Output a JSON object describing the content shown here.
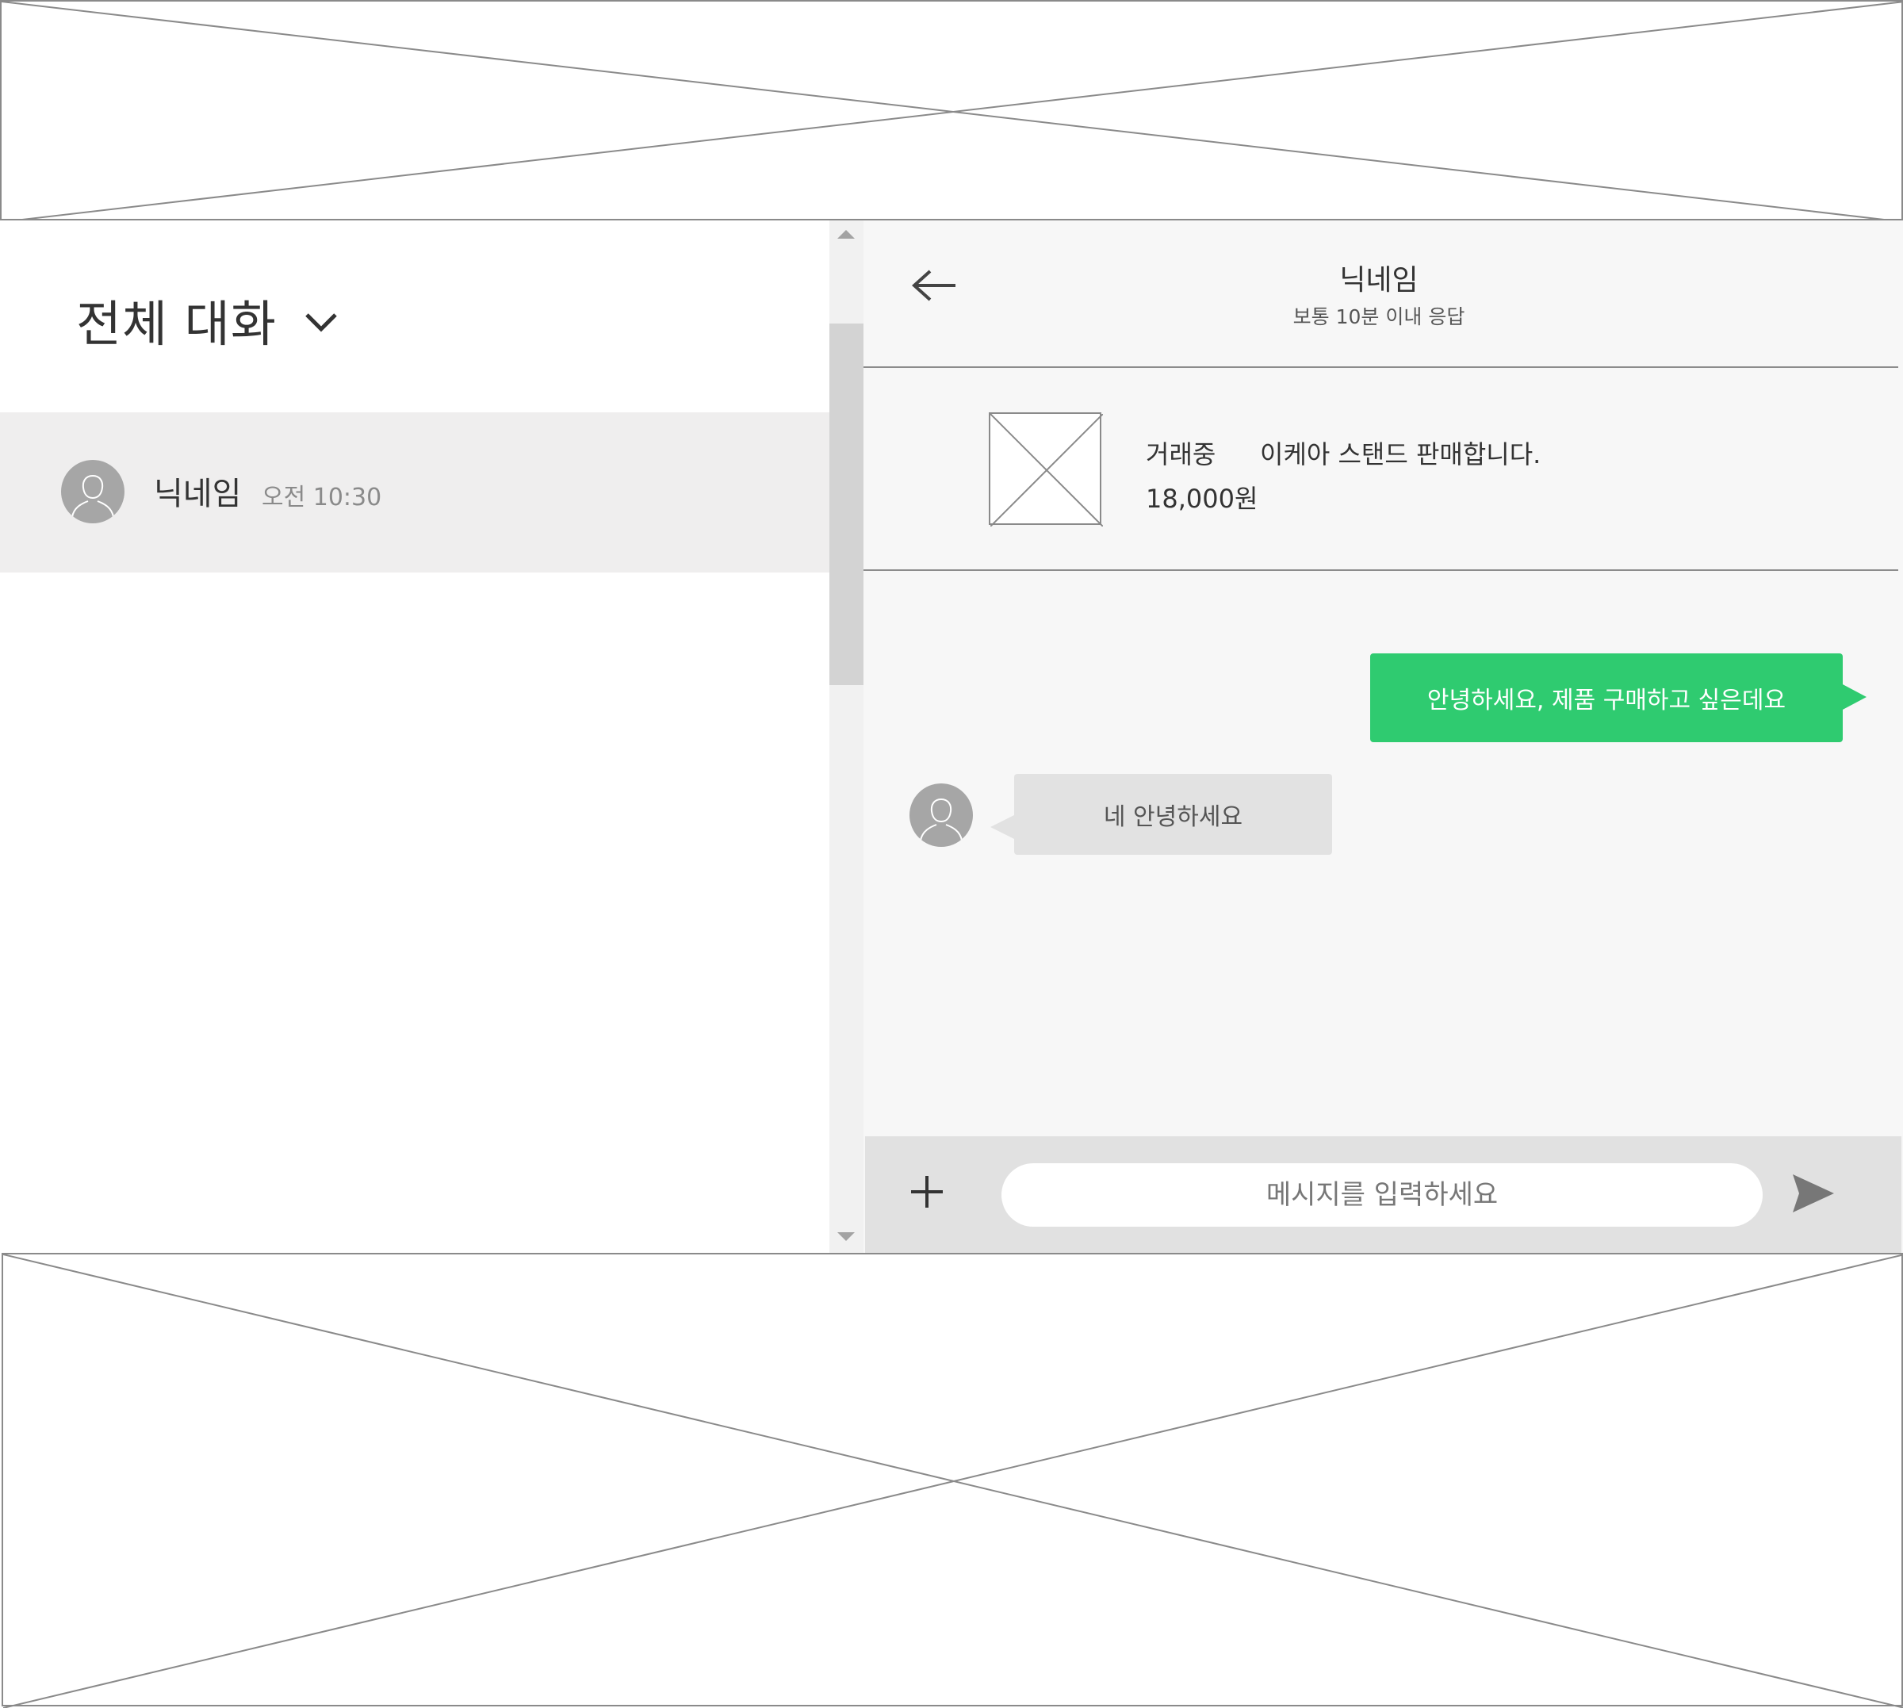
{
  "conversation_list": {
    "filter_label": "전체 대화",
    "items": [
      {
        "name": "닉네임",
        "time": "오전 10:30"
      }
    ]
  },
  "chat": {
    "partner_name": "닉네임",
    "response_time": "보통 10분 이내 응답",
    "product": {
      "status": "거래중",
      "title": "이케아 스탠드 판매합니다.",
      "price": "18,000원"
    },
    "messages": [
      {
        "direction": "outgoing",
        "text": "안녕하세요, 제품 구매하고 싶은데요"
      },
      {
        "direction": "incoming",
        "text": "네 안녕하세요"
      }
    ],
    "input": {
      "placeholder": "메시지를 입력하세요"
    }
  },
  "colors": {
    "outgoing_bubble": "#2fcb70",
    "incoming_bubble": "#e2e2e2",
    "selected_row": "#efeeee",
    "chat_background": "#f7f7f7",
    "input_bar": "#e1e1e1"
  },
  "icons": [
    "dropdown-chevron-icon",
    "user-avatar-icon",
    "back-arrow-icon",
    "image-placeholder-icon",
    "plus-icon",
    "send-icon"
  ]
}
